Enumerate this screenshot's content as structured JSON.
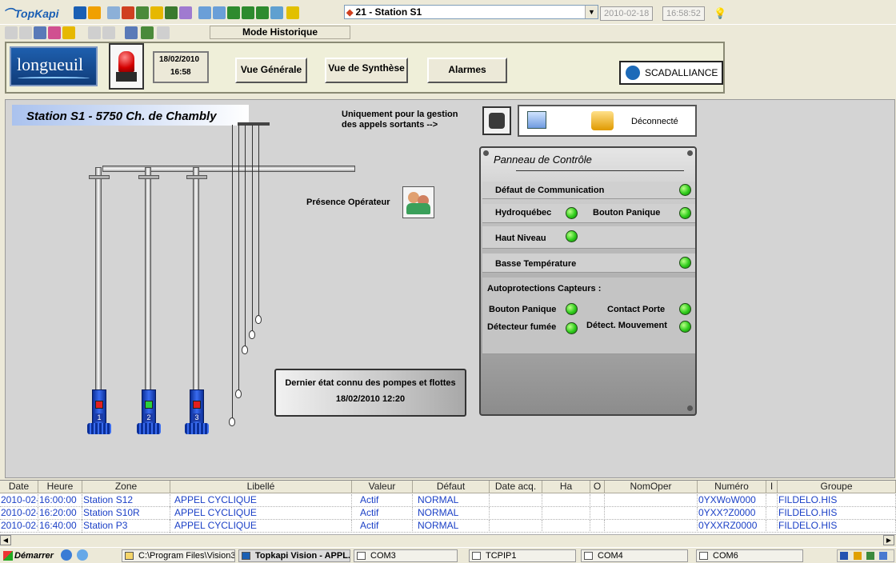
{
  "app": {
    "name": "TopKapi",
    "mode": "Mode Historique"
  },
  "station_selector": {
    "value": "21 - Station S1"
  },
  "toolbar": {
    "date": "2010-02-18",
    "time": "16:58:52"
  },
  "header": {
    "logo": "longueuil",
    "date": "18/02/2010",
    "time": "16:58",
    "nav": [
      "Vue Générale",
      "Vue de Synthèse",
      "Alarmes"
    ],
    "brand": "SCADALLIANCE"
  },
  "synoptic": {
    "title": "Station S1 - 5750 Ch. de Chambly",
    "calls_note_line1": "Uniquement pour la gestion",
    "calls_note_line2": "des appels sortants  -->",
    "comm_status": "Déconnecté",
    "operator_label": "Présence Opérateur",
    "pumps": [
      {
        "number": "1",
        "state_color": "#e21f1f"
      },
      {
        "number": "2",
        "state_color": "#2ad13c"
      },
      {
        "number": "3",
        "state_color": "#e21f1f"
      }
    ],
    "last_state_line1": "Dernier état connu des pompes et flottes",
    "last_state_line2": "18/02/2010 12:20"
  },
  "control_panel": {
    "title": "Panneau de Contrôle",
    "items": {
      "comm_fault": "Défaut de Communication",
      "hydro": "Hydroquébec",
      "panic": "Bouton Panique",
      "high_level": "Haut Niveau",
      "low_temp": "Basse Température",
      "auto_title": "Autoprotections Capteurs :",
      "panic2": "Bouton Panique",
      "door": "Contact Porte",
      "smoke": "Détecteur fumée",
      "motion": "Détect. Mouvement"
    }
  },
  "events": {
    "columns": [
      "Date",
      "Heure",
      "Zone",
      "Libellé",
      "Valeur",
      "Défaut",
      "Date acq.",
      "Ha",
      "O",
      "NomOper",
      "Numéro",
      "I",
      "Groupe"
    ],
    "rows": [
      [
        "2010-02-",
        "16:00:00",
        "Station S12",
        "APPEL CYCLIQUE",
        "Actif",
        "NORMAL",
        "",
        "",
        "",
        "",
        "0YXWoW000",
        "",
        "FILDELO.HIS"
      ],
      [
        "2010-02-",
        "16:20:00",
        "Station S10R",
        "APPEL CYCLIQUE",
        "Actif",
        "NORMAL",
        "",
        "",
        "",
        "",
        "0YXX?Z0000",
        "",
        "FILDELO.HIS"
      ],
      [
        "2010-02-",
        "16:40:00",
        "Station P3",
        "APPEL CYCLIQUE",
        "Actif",
        "NORMAL",
        "",
        "",
        "",
        "",
        "0YXXRZ0000",
        "",
        "FILDELO.HIS"
      ]
    ]
  },
  "taskbar": {
    "start": "Démarrer",
    "tasks": [
      "C:\\Program Files\\Vision3...",
      "Topkapi Vision - APPL...",
      "COM3",
      "TCPIP1",
      "COM4",
      "COM6"
    ]
  }
}
